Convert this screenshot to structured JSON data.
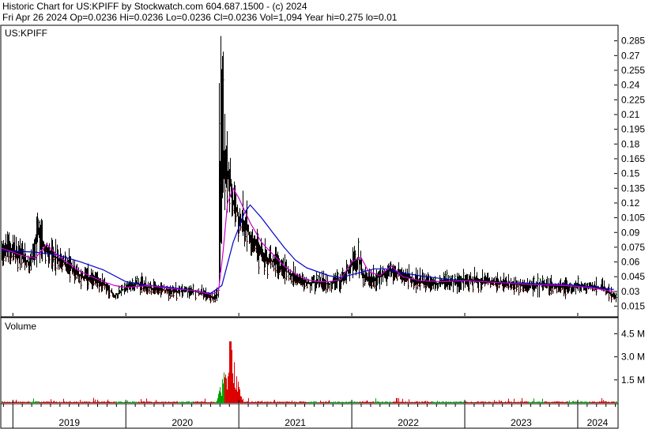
{
  "header": {
    "line1": "Historic Chart for US:KPIFF by Stockwatch.com 604.687.1500 - (c) 2024",
    "line2": "Fri Apr 26 2024   Op=0.0236   Hi=0.0236   Lo=0.0236   Cl=0.0236   Vol=1,094   Year hi=0.275   lo=0.01"
  },
  "colors": {
    "price_bar": "#000000",
    "up_bar": "#008000",
    "down_bar": "#cc0000",
    "ma_short": "#cc00cc",
    "ma_long": "#0000cc",
    "volume_up": "#00a000",
    "volume_down": "#dd0000",
    "frame": "#000000",
    "gridline": "#aaaaaa"
  },
  "chart_data": [
    {
      "type": "line",
      "panel": "price",
      "symbol_label": "US:KPIFF",
      "ylim": [
        0.005,
        0.3
      ],
      "yticks": [
        0.015,
        0.03,
        0.045,
        0.06,
        0.075,
        0.09,
        0.105,
        0.12,
        0.135,
        0.15,
        0.165,
        0.18,
        0.195,
        0.21,
        0.225,
        0.24,
        0.255,
        0.27,
        0.285
      ],
      "ytick_labels": [
        "0.015",
        "0.03",
        "0.045",
        "0.06",
        "0.075",
        "0.09",
        "0.105",
        "0.12",
        "0.135",
        "0.15",
        "0.165",
        "0.18",
        "0.195",
        "0.21",
        "0.225",
        "0.24",
        "0.255",
        "0.27",
        "0.285"
      ],
      "x_range": [
        2018.9,
        2024.35
      ],
      "xtick_years": [
        2019,
        2020,
        2021,
        2022,
        2023,
        2024
      ],
      "xtick_labels": [
        "2019",
        "2020",
        "2021",
        "2022",
        "2023",
        "2024"
      ],
      "series": [
        {
          "role": "price",
          "x": [
            2018.9,
            2019.0,
            2019.08,
            2019.15,
            2019.22,
            2019.3,
            2019.4,
            2019.5,
            2019.6,
            2019.7,
            2019.8,
            2019.9,
            2020.0,
            2020.1,
            2020.2,
            2020.3,
            2020.45,
            2020.6,
            2020.7,
            2020.78,
            2020.82,
            2020.84,
            2020.86,
            2020.9,
            2020.95,
            2021.0,
            2021.05,
            2021.1,
            2021.2,
            2021.3,
            2021.4,
            2021.5,
            2021.6,
            2021.7,
            2021.8,
            2021.9,
            2022.0,
            2022.06,
            2022.1,
            2022.2,
            2022.3,
            2022.35,
            2022.45,
            2022.55,
            2022.7,
            2022.85,
            2023.0,
            2023.2,
            2023.4,
            2023.55,
            2023.7,
            2023.9,
            2024.1,
            2024.25,
            2024.32
          ],
          "y": [
            0.075,
            0.072,
            0.066,
            0.058,
            0.09,
            0.07,
            0.063,
            0.056,
            0.046,
            0.042,
            0.038,
            0.025,
            0.035,
            0.038,
            0.034,
            0.032,
            0.03,
            0.03,
            0.027,
            0.024,
            0.028,
            0.09,
            0.16,
            0.15,
            0.12,
            0.105,
            0.098,
            0.085,
            0.068,
            0.06,
            0.052,
            0.044,
            0.038,
            0.04,
            0.038,
            0.042,
            0.058,
            0.065,
            0.045,
            0.042,
            0.05,
            0.052,
            0.046,
            0.042,
            0.038,
            0.04,
            0.042,
            0.04,
            0.038,
            0.036,
            0.037,
            0.034,
            0.035,
            0.033,
            0.0236
          ]
        },
        {
          "role": "ma_short",
          "x": [
            2018.9,
            2019.0,
            2019.1,
            2019.2,
            2019.3,
            2019.4,
            2019.5,
            2019.6,
            2019.7,
            2019.8,
            2019.9,
            2020.0,
            2020.2,
            2020.4,
            2020.6,
            2020.75,
            2020.82,
            2020.86,
            2020.9,
            2020.95,
            2021.0,
            2021.1,
            2021.2,
            2021.3,
            2021.4,
            2021.5,
            2021.6,
            2021.7,
            2021.8,
            2021.9,
            2022.0,
            2022.08,
            2022.15,
            2022.25,
            2022.35,
            2022.45,
            2022.6,
            2022.8,
            2023.0,
            2023.3,
            2023.6,
            2023.9,
            2024.1,
            2024.32
          ],
          "y": [
            0.074,
            0.07,
            0.066,
            0.064,
            0.078,
            0.066,
            0.058,
            0.05,
            0.045,
            0.04,
            0.036,
            0.034,
            0.036,
            0.033,
            0.031,
            0.027,
            0.03,
            0.07,
            0.12,
            0.135,
            0.125,
            0.1,
            0.08,
            0.068,
            0.056,
            0.048,
            0.042,
            0.04,
            0.04,
            0.042,
            0.06,
            0.065,
            0.05,
            0.046,
            0.056,
            0.045,
            0.041,
            0.04,
            0.041,
            0.039,
            0.037,
            0.036,
            0.034,
            0.03
          ]
        },
        {
          "role": "ma_long",
          "x": [
            2018.9,
            2019.0,
            2019.2,
            2019.4,
            2019.6,
            2019.8,
            2020.0,
            2020.2,
            2020.4,
            2020.6,
            2020.75,
            2020.85,
            2020.95,
            2021.05,
            2021.1,
            2021.2,
            2021.3,
            2021.4,
            2021.5,
            2021.6,
            2021.7,
            2021.8,
            2021.9,
            2022.0,
            2022.1,
            2022.2,
            2022.3,
            2022.4,
            2022.6,
            2022.8,
            2023.0,
            2023.3,
            2023.6,
            2023.9,
            2024.1,
            2024.32
          ],
          "y": [
            0.072,
            0.071,
            0.07,
            0.067,
            0.06,
            0.052,
            0.04,
            0.036,
            0.034,
            0.031,
            0.028,
            0.036,
            0.08,
            0.11,
            0.118,
            0.105,
            0.09,
            0.075,
            0.062,
            0.054,
            0.05,
            0.046,
            0.044,
            0.047,
            0.05,
            0.053,
            0.053,
            0.05,
            0.046,
            0.043,
            0.041,
            0.039,
            0.038,
            0.037,
            0.035,
            0.032
          ]
        }
      ]
    },
    {
      "type": "bar",
      "panel": "volume",
      "panel_label": "Volume",
      "ylim": [
        0,
        5500000
      ],
      "yticks": [
        1500000,
        3000000,
        4500000
      ],
      "ytick_labels": [
        "1.5 M",
        "3.0 M",
        "4.5 M"
      ],
      "peak_volume": 4000000,
      "peak_date": 2020.92
    }
  ]
}
